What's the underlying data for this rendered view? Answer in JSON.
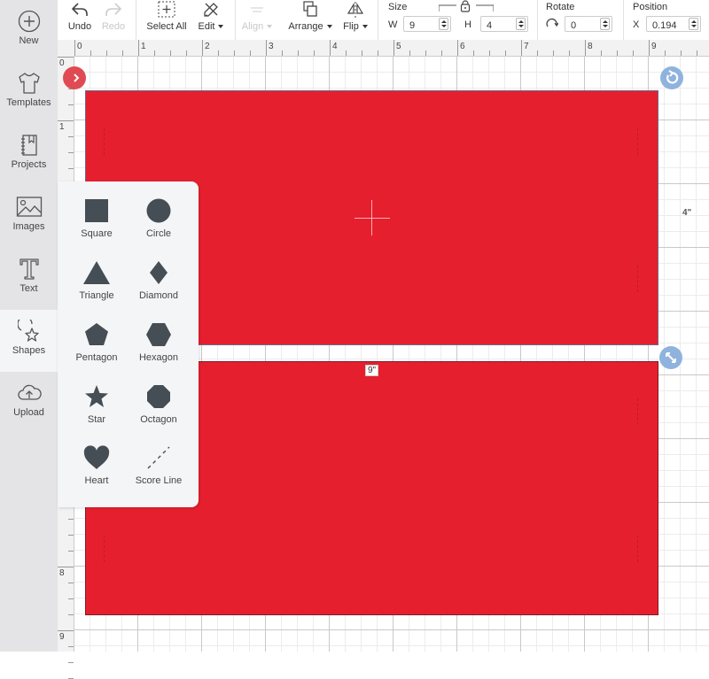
{
  "sidebar": {
    "items": [
      {
        "label": "New",
        "icon": "plus-circle-icon"
      },
      {
        "label": "Templates",
        "icon": "tshirt-icon"
      },
      {
        "label": "Projects",
        "icon": "notebook-icon"
      },
      {
        "label": "Images",
        "icon": "image-icon"
      },
      {
        "label": "Text",
        "icon": "text-t-icon"
      },
      {
        "label": "Shapes",
        "icon": "shapes-icon",
        "active": true
      },
      {
        "label": "Upload",
        "icon": "cloud-upload-icon"
      }
    ]
  },
  "toolbar": {
    "undo": "Undo",
    "redo": "Redo",
    "select_all": "Select All",
    "edit": "Edit",
    "align": "Align",
    "arrange": "Arrange",
    "flip": "Flip",
    "size": {
      "title": "Size",
      "w_label": "W",
      "w_value": "9",
      "h_label": "H",
      "h_value": "4"
    },
    "rotate": {
      "title": "Rotate",
      "value": "0"
    },
    "position": {
      "title": "Position",
      "x_label": "X",
      "x_value": "0.194"
    }
  },
  "rulers": {
    "horizontal": [
      "0",
      "1",
      "2",
      "3",
      "4",
      "5",
      "6",
      "7",
      "8",
      "9"
    ],
    "vertical": [
      "0",
      "1",
      "8",
      "9"
    ]
  },
  "canvas": {
    "fill_color": "#e61f2e",
    "width_label": "9\"",
    "height_label": "4\""
  },
  "shapes_panel": {
    "items": [
      {
        "label": "Square"
      },
      {
        "label": "Circle"
      },
      {
        "label": "Triangle"
      },
      {
        "label": "Diamond"
      },
      {
        "label": "Pentagon"
      },
      {
        "label": "Hexagon"
      },
      {
        "label": "Star"
      },
      {
        "label": "Octagon"
      },
      {
        "label": "Heart"
      },
      {
        "label": "Score Line"
      }
    ]
  }
}
